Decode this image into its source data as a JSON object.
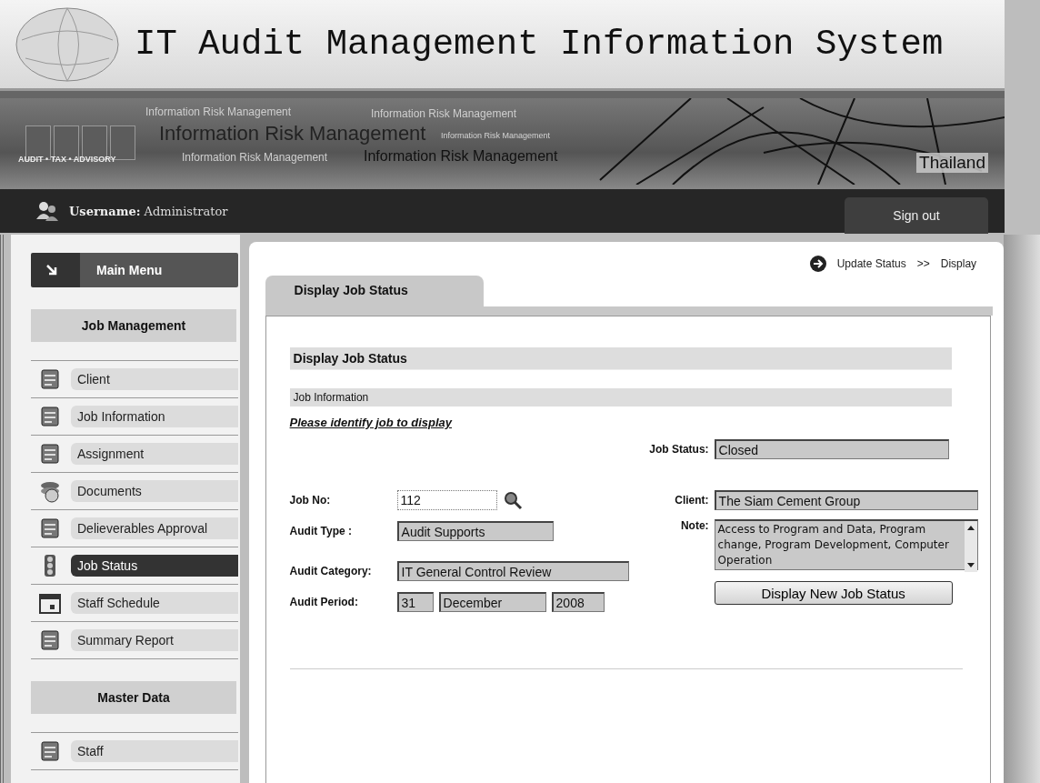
{
  "title": "IT Audit Management Information System",
  "banner": {
    "texts": [
      {
        "text": "Information Risk Management",
        "kind": "faint"
      },
      {
        "text": "Information Risk Management",
        "kind": "faint"
      },
      {
        "text": "Information Risk Management",
        "kind": "large"
      },
      {
        "text": "Information Risk Management",
        "kind": "tiny"
      },
      {
        "text": "Information Risk Management",
        "kind": "faint"
      },
      {
        "text": "Information Risk Management",
        "kind": "medium"
      }
    ],
    "tagline": "AUDIT • TAX • ADVISORY",
    "country": "Thailand"
  },
  "user_bar": {
    "label": "Username:",
    "username": "Administrator",
    "sign_out": "Sign out"
  },
  "sidebar": {
    "main_menu": "Main Menu",
    "sections": [
      {
        "heading": "Job Management",
        "items": [
          {
            "label": "Client",
            "selected": false
          },
          {
            "label": "Job Information",
            "selected": false
          },
          {
            "label": "Assignment",
            "selected": false
          },
          {
            "label": "Documents",
            "selected": false
          },
          {
            "label": "Delieverables Approval",
            "selected": false
          },
          {
            "label": "Job Status",
            "selected": true
          },
          {
            "label": "Staff Schedule",
            "selected": false
          },
          {
            "label": "Summary Report",
            "selected": false
          }
        ]
      },
      {
        "heading": "Master Data",
        "items": [
          {
            "label": "Staff",
            "selected": false
          }
        ]
      }
    ]
  },
  "breadcrumb": {
    "link": "Update Status",
    "separator": ">>",
    "current": "Display"
  },
  "tabs": [
    {
      "label": "Display Job Status",
      "selected": true
    }
  ],
  "form": {
    "heading": "Display Job Status",
    "section": "Job Information",
    "link": "Please identify job to display",
    "job_status": {
      "label": "Job Status:",
      "value": "Closed"
    },
    "job_no": {
      "label": "Job No:",
      "value": "112"
    },
    "client": {
      "label": "Client:",
      "value": "The Siam Cement Group"
    },
    "audit_type": {
      "label": "Audit Type :",
      "value": "Audit Supports"
    },
    "note": {
      "label": "Note:",
      "value": "Access to Program and Data, Program change, Program Development, Computer Operation"
    },
    "audit_category": {
      "label": "Audit Category:",
      "value": "IT General Control Review"
    },
    "audit_period": {
      "label": "Audit Period:",
      "day": "31",
      "month": "December",
      "year": "2008"
    },
    "button": "Display New Job Status"
  }
}
